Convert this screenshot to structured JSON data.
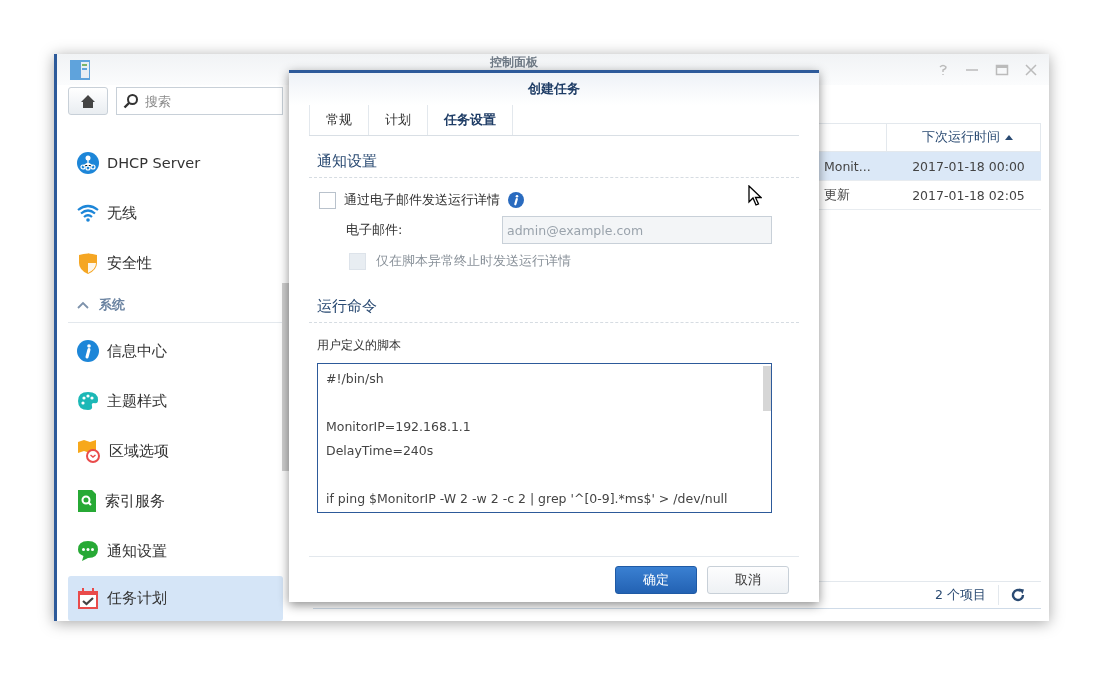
{
  "window": {
    "title": "控制面板"
  },
  "sidebar": {
    "search": {
      "placeholder": "搜索"
    },
    "items": [
      {
        "kind": "item",
        "label": "DHCP Server",
        "selected": false
      },
      {
        "kind": "item",
        "label": "无线",
        "selected": false
      },
      {
        "kind": "item",
        "label": "安全性",
        "selected": false
      },
      {
        "kind": "section",
        "label": "系统",
        "expanded": true
      },
      {
        "kind": "item",
        "label": "信息中心",
        "selected": false
      },
      {
        "kind": "item",
        "label": "主题样式",
        "selected": false
      },
      {
        "kind": "item",
        "label": "区域选项",
        "selected": false
      },
      {
        "kind": "item",
        "label": "索引服务",
        "selected": false
      },
      {
        "kind": "item",
        "label": "通知设置",
        "selected": false
      },
      {
        "kind": "item",
        "label": "任务计划",
        "selected": true
      }
    ]
  },
  "table": {
    "columns": [
      {
        "label": "下次运行时间",
        "sort_ascending": true
      }
    ],
    "rows": [
      {
        "column_1": "Monit...",
        "next_run": "2017-01-18 00:00",
        "selected": true
      },
      {
        "column_1": "更新",
        "next_run": "2017-01-18 02:05",
        "selected": false
      }
    ]
  },
  "status_bar": {
    "count": "2 个项目"
  },
  "dialog": {
    "title": "创建任务",
    "tabs": [
      {
        "label": "常规",
        "selected": false
      },
      {
        "label": "计划",
        "selected": false
      },
      {
        "label": "任务设置",
        "selected": true
      }
    ],
    "notification": {
      "heading": "通知设置",
      "email_checkbox": {
        "label": "通过电子邮件发送运行详情",
        "checked": false
      },
      "email_label": "电子邮件:",
      "email_field": {
        "placeholder": "admin@example.com",
        "disabled": true
      },
      "abnormal_checkbox": {
        "label": "仅在脚本异常终止时发送运行详情",
        "checked": false,
        "disabled": true
      }
    },
    "command": {
      "heading": "运行命令",
      "label": "用户定义的脚本",
      "script": "#!/bin/sh\n\nMonitorIP=192.168.1.1\nDelayTime=240s\n\nif ping $MonitorIP -W 2 -w 2 -c 2 | grep '^[0-9].*ms$' > /dev/null"
    },
    "buttons": [
      {
        "label": "确定",
        "kind": "primary"
      },
      {
        "label": "取消",
        "kind": "secondary"
      }
    ]
  }
}
